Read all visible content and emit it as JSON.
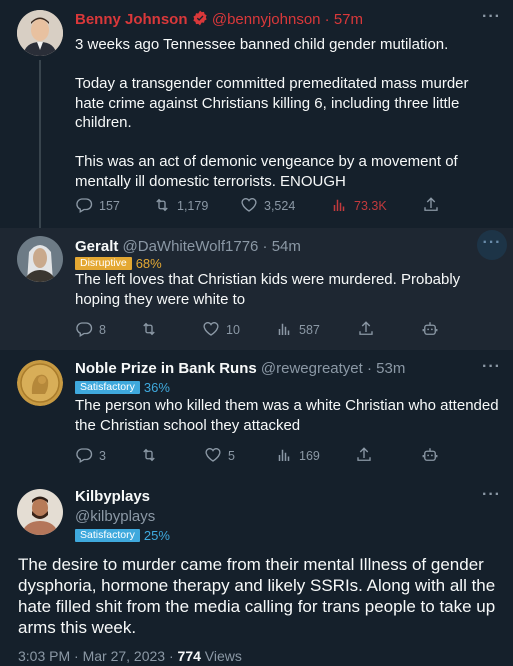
{
  "tweets": [
    {
      "name": "Benny Johnson",
      "handle": "@bennyjohnson",
      "time": "57m",
      "text": "3 weeks ago Tennessee banned child gender mutilation.\n\nToday a transgender committed premeditated mass murder hate crime against Christians killing 6, including three little children.\n\nThis was an act of demonic vengeance by a movement of mentally ill domestic terrorists. ENOUGH",
      "replies": "157",
      "retweets": "1,179",
      "likes": "3,524",
      "views": "73.3K",
      "verified": true
    },
    {
      "name": "Geralt",
      "handle": "@DaWhiteWolf1776",
      "time": "54m",
      "badge": "Disruptive",
      "badge_pct": "68%",
      "text": "The left loves that Christian kids were murdered. Probably hoping they were white to",
      "replies": "8",
      "retweets": "",
      "likes": "10",
      "views": "587"
    },
    {
      "name": "Noble Prize in Bank Runs",
      "handle": "@rewegreatyet",
      "time": "53m",
      "badge": "Satisfactory",
      "badge_pct": "36%",
      "text": "The person who killed them was a white Christian who attended the Christian school they attacked",
      "replies": "3",
      "retweets": "",
      "likes": "5",
      "views": "169"
    },
    {
      "name": "Kilbyplays",
      "handle": "@kilbyplays",
      "badge": "Satisfactory",
      "badge_pct": "25%",
      "text": "The desire to murder came from their mental Illness of gender dysphoria, hormone therapy and likely SSRIs. Along with all the hate filled shit from the media calling for trans people to take up arms this week.",
      "timestamp": "3:03 PM · Mar 27, 2023 · ",
      "views_count": "774",
      "views_label": " Views"
    }
  ],
  "ui": {
    "dot": " · ",
    "more": "···"
  },
  "colors": {
    "bg": "#15202b",
    "highlight_bg": "#1e2732",
    "red": "#d9383a",
    "muted": "#8b98a5"
  }
}
